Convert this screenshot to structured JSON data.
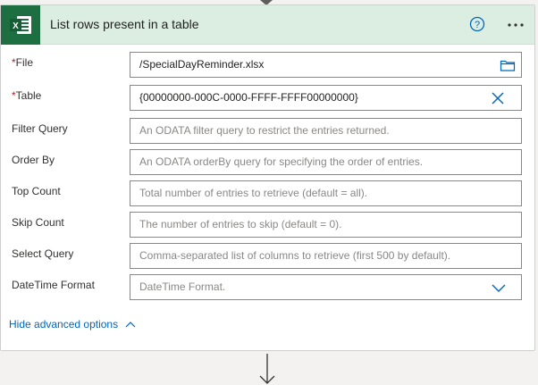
{
  "card": {
    "title": "List rows present in a table",
    "help_icon": "question-circle-icon",
    "more_icon": "ellipsis-icon",
    "brand_color": "#1d6f42",
    "header_color": "#dceee2"
  },
  "fields": [
    {
      "label": "File",
      "required": true,
      "value": "/SpecialDayReminder.xlsx",
      "placeholder": "",
      "icon": "folder-icon"
    },
    {
      "label": "Table",
      "required": true,
      "value": "{00000000-000C-0000-FFFF-FFFF00000000}",
      "placeholder": "",
      "icon": "clear-icon"
    },
    {
      "label": "Filter Query",
      "required": false,
      "value": "",
      "placeholder": "An ODATA filter query to restrict the entries returned."
    },
    {
      "label": "Order By",
      "required": false,
      "value": "",
      "placeholder": "An ODATA orderBy query for specifying the order of entries."
    },
    {
      "label": "Top Count",
      "required": false,
      "value": "",
      "placeholder": "Total number of entries to retrieve (default = all)."
    },
    {
      "label": "Skip Count",
      "required": false,
      "value": "",
      "placeholder": "The number of entries to skip (default = 0)."
    },
    {
      "label": "Select Query",
      "required": false,
      "value": "",
      "placeholder": "Comma-separated list of columns to retrieve (first 500 by default)."
    },
    {
      "label": "DateTime Format",
      "required": false,
      "value": "",
      "placeholder": "DateTime Format.",
      "icon": "chevron-down-icon"
    }
  ],
  "advanced": {
    "label": "Hide advanced options"
  },
  "required_marker": "*"
}
